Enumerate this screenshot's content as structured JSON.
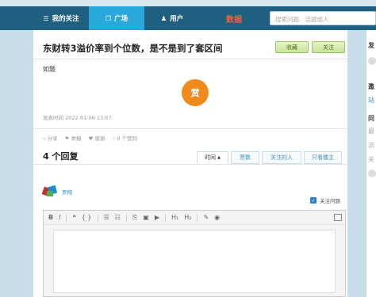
{
  "nav": {
    "items": [
      {
        "label": "我的关注",
        "icon": "list-icon"
      },
      {
        "label": "广场",
        "icon": "copy-icon"
      },
      {
        "label": "用户",
        "icon": "user-icon"
      },
      {
        "label": "数据",
        "icon": ""
      }
    ],
    "search_placeholder": "搜索问题、话题或人"
  },
  "question": {
    "title": "东财转3溢价率到个位数，是不是到了套区间",
    "collect_label": "收藏",
    "follow_label": "关注",
    "body": "如题",
    "reward_label": "赏",
    "posted_time": "发表时间 2022-01-06 13:07",
    "actions": {
      "share": "分享",
      "report": "举报",
      "thanks": "感谢",
      "likes": "0 个赞同"
    }
  },
  "answers": {
    "count_title": "4 个回复",
    "tabs": [
      "时间",
      "票数",
      "关注的人",
      "只看楼主"
    ],
    "active_tab": "时间"
  },
  "reply": {
    "username": "罗翔",
    "follow_question_label": "关注问题",
    "toolbar": [
      "B",
      "I",
      "❝",
      "{ }",
      "☰",
      "☷",
      "⎘",
      "▣",
      "▶",
      "H₁",
      "H₂",
      "✎",
      "◉"
    ]
  },
  "sidebar_fragments": {
    "a": "发",
    "b": "邀",
    "c": "站",
    "d": "问",
    "e": "最",
    "f": "浏",
    "g": "关"
  },
  "colors": {
    "header": "#1f5f80",
    "active_tab": "#2aa8d9",
    "data_red": "#ff5a3c",
    "reward_orange": "#f08a1c",
    "link_blue": "#3e8ec0"
  }
}
